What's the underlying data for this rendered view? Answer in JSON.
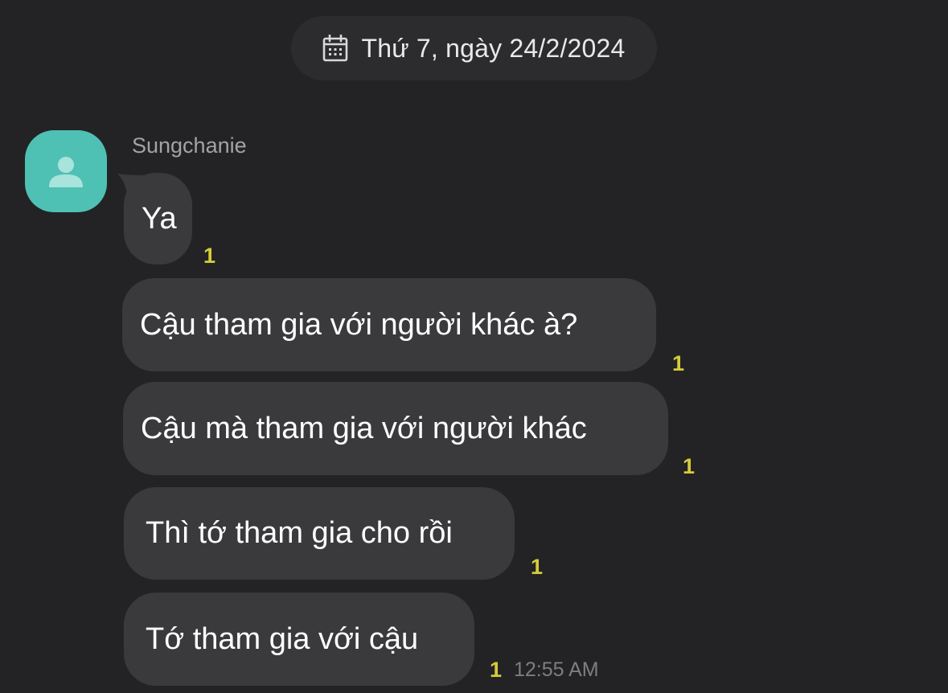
{
  "date_header": {
    "icon": "calendar-icon",
    "text": "Thứ 7, ngày 24/2/2024"
  },
  "sender": {
    "name": "Sungchanie",
    "avatar_icon": "person-icon",
    "avatar_color": "#4fc0b4"
  },
  "messages": [
    {
      "text": "Ya",
      "unread_count": "1"
    },
    {
      "text": "Cậu tham gia với người khác à?",
      "unread_count": "1"
    },
    {
      "text": "Cậu mà tham gia với người khác",
      "unread_count": "1"
    },
    {
      "text": "Thì tớ tham gia cho rồi",
      "unread_count": "1"
    },
    {
      "text": "Tớ tham gia với cậu",
      "unread_count": "1",
      "time": "12:55 AM"
    }
  ],
  "colors": {
    "background": "#232325",
    "bubble": "#3a3a3d",
    "unread": "#d6cb3a",
    "time": "#7e7e82"
  }
}
